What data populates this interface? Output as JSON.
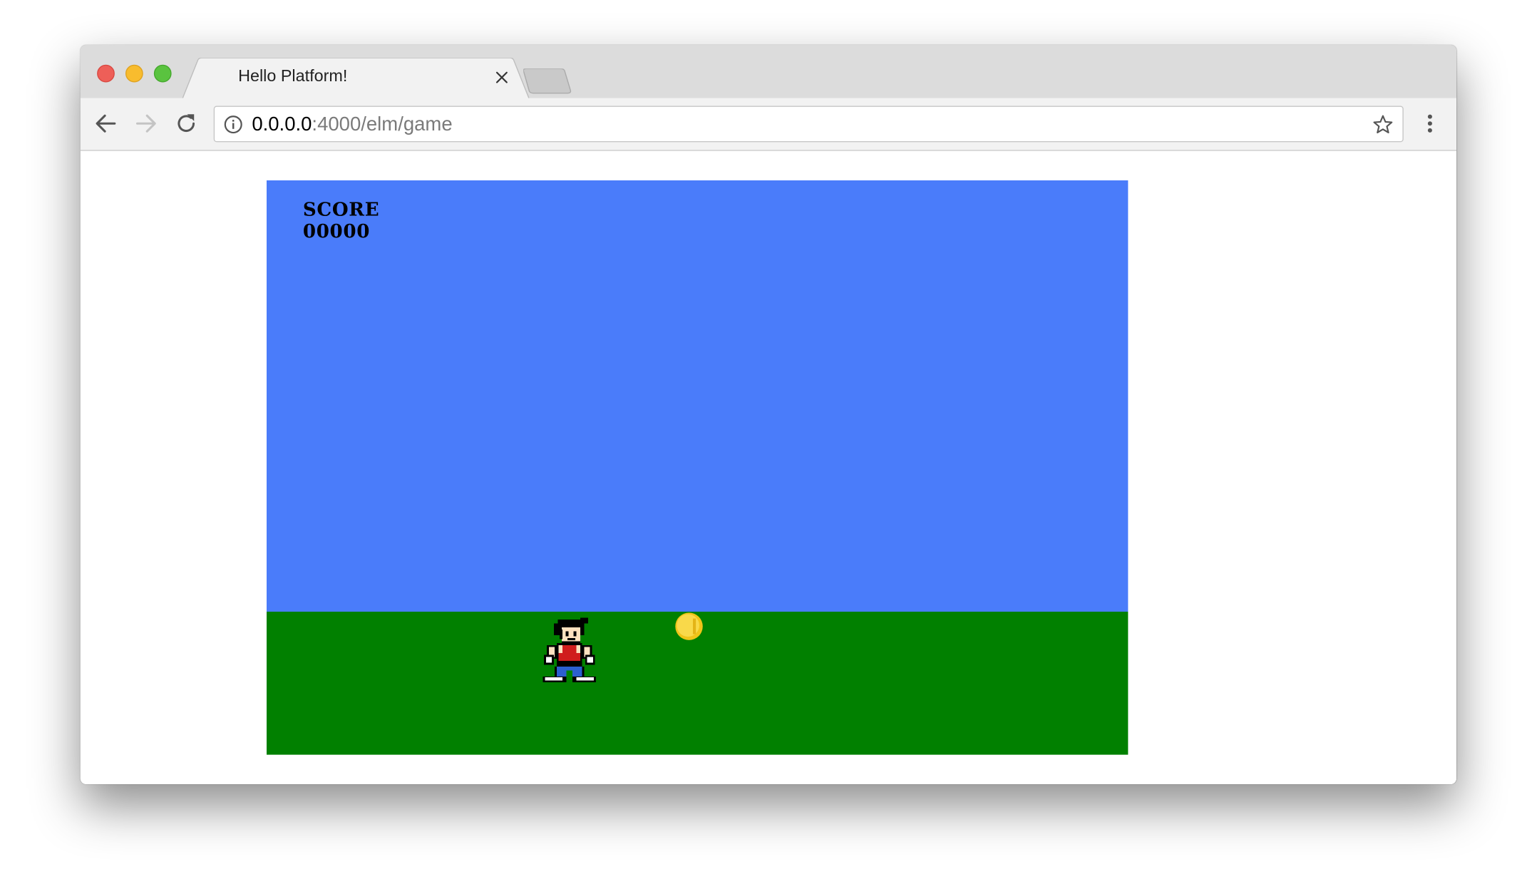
{
  "browser": {
    "tab_title": "Hello Platform!",
    "url_host": "0.0.0.0",
    "url_path": ":4000/elm/game",
    "colors": {
      "close": "#ee5f58",
      "minimize": "#f8bc2e",
      "maximize": "#5ac33f"
    }
  },
  "game": {
    "score_label": "SCORE",
    "score_value": "00000",
    "colors": {
      "sky": "#4a7cfa",
      "ground": "#018000",
      "coin": "#f6d02a"
    }
  }
}
